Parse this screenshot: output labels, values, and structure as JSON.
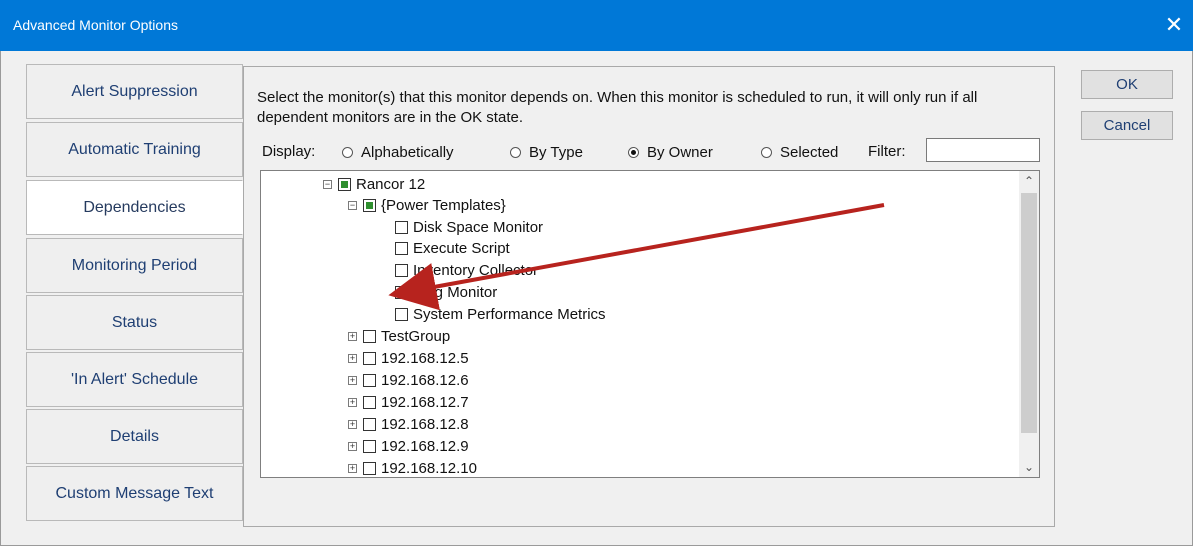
{
  "window": {
    "title": "Advanced Monitor Options",
    "close_icon": "close-icon"
  },
  "tabs": [
    {
      "label": "Alert Suppression"
    },
    {
      "label": "Automatic Training"
    },
    {
      "label": "Dependencies"
    },
    {
      "label": "Monitoring Period"
    },
    {
      "label": "Status"
    },
    {
      "label": "'In Alert' Schedule"
    },
    {
      "label": "Details"
    },
    {
      "label": "Custom Message Text"
    }
  ],
  "panel": {
    "description": "Select the monitor(s) that this monitor depends on.  When this monitor is scheduled to run, it will only run if all dependent monitors  are in the OK state.",
    "display_label": "Display:",
    "display_options": [
      {
        "label": "Alphabetically"
      },
      {
        "label": "By Type"
      },
      {
        "label": "By Owner"
      },
      {
        "label": "Selected"
      }
    ],
    "filter_label": "Filter:",
    "filter_value": ""
  },
  "tree": {
    "nodes": [
      {
        "label": "Rancor 12",
        "expander": "−",
        "check": "partial"
      },
      {
        "label": "{Power Templates}",
        "expander": "−",
        "check": "partial"
      },
      {
        "label": "Disk Space Monitor",
        "check": "unchecked"
      },
      {
        "label": "Execute Script",
        "check": "unchecked"
      },
      {
        "label": "Inventory Collector",
        "check": "unchecked"
      },
      {
        "label": "Ping Monitor",
        "check": "checked"
      },
      {
        "label": "System Performance Metrics",
        "check": "unchecked"
      },
      {
        "label": "TestGroup",
        "expander": "+",
        "check": "unchecked"
      },
      {
        "label": "192.168.12.5",
        "expander": "+",
        "check": "unchecked"
      },
      {
        "label": "192.168.12.6",
        "expander": "+",
        "check": "unchecked"
      },
      {
        "label": "192.168.12.7",
        "expander": "+",
        "check": "unchecked"
      },
      {
        "label": "192.168.12.8",
        "expander": "+",
        "check": "unchecked"
      },
      {
        "label": "192.168.12.9",
        "expander": "+",
        "check": "unchecked"
      },
      {
        "label": "192.168.12.10",
        "expander": "+",
        "check": "unchecked"
      }
    ]
  },
  "buttons": {
    "ok": "OK",
    "cancel": "Cancel"
  }
}
